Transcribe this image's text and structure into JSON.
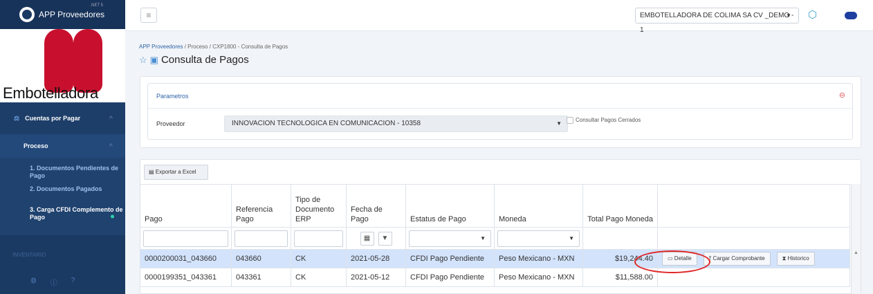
{
  "app": {
    "title": "APP Proveedores",
    "version": ".NET 5",
    "brand_name": "Embotelladora"
  },
  "sidebar": {
    "items": [
      {
        "label": "Cuentas por Pagar"
      },
      {
        "label": "Proceso"
      }
    ],
    "subitems": [
      {
        "label": "1. Documentos Pendientes de Pago"
      },
      {
        "label": "2. Documentos Pagados"
      },
      {
        "label": "3. Carga CFDI Complemento de Pago"
      }
    ],
    "section": "INVENTARIO"
  },
  "topbar": {
    "company": "EMBOTELLADORA DE COLIMA SA CV _DEMO - 1"
  },
  "breadcrumb": {
    "root": "APP Proveedores",
    "level2": "Proceso",
    "current": "CXP1800 - Consulta de Pagos",
    "sep": "/"
  },
  "page": {
    "title": "Consulta de Pagos"
  },
  "params": {
    "title": "Parametros",
    "proveedor_label": "Proveedor",
    "proveedor_value": "INNOVACION TECNOLOGICA EN COMUNICACION - 10358",
    "cerrados_label": "Consultar Pagos Cerrados"
  },
  "toolbar": {
    "export_label": "Exportar a Excel"
  },
  "table": {
    "headers": [
      "Pago",
      "Referencia Pago",
      "Tipo de Documento ERP",
      "Fecha de Pago",
      "Estatus de Pago",
      "Moneda",
      "Total Pago Moneda"
    ],
    "rows": [
      {
        "pago": "0000200031_043660",
        "ref": "043660",
        "tipo": "CK",
        "fecha": "2021-05-28",
        "estatus": "CFDI Pago Pendiente",
        "moneda": "Peso Mexicano - MXN",
        "total": "$19,244.40"
      },
      {
        "pago": "0000199351_043361",
        "ref": "043361",
        "tipo": "CK",
        "fecha": "2021-05-12",
        "estatus": "CFDI Pago Pendiente",
        "moneda": "Peso Mexicano - MXN",
        "total": "$11,588.00"
      }
    ],
    "actions": {
      "detalle": "Detalle",
      "cargar": "Cargar Comprobante",
      "historico": "Historico"
    }
  }
}
